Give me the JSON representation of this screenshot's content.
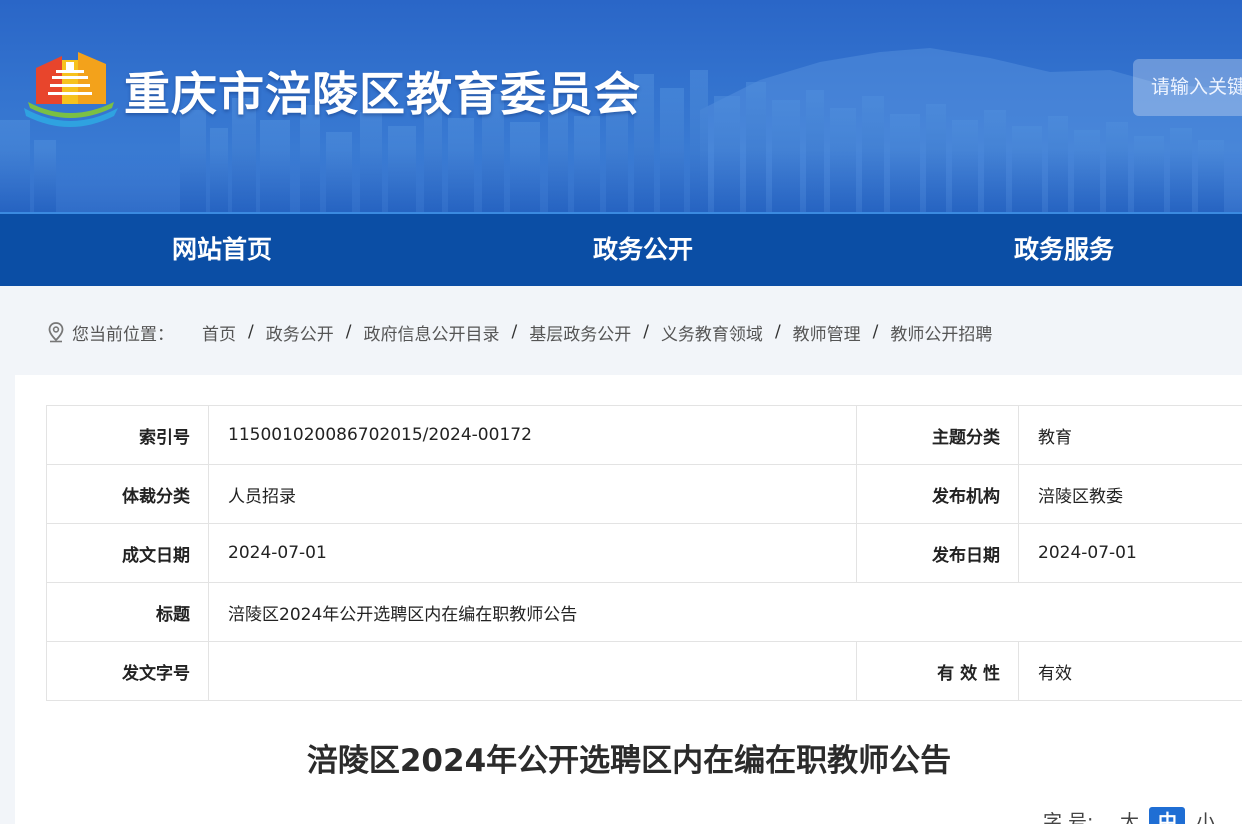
{
  "header": {
    "site_title": "重庆市涪陵区教育委员会",
    "search_placeholder": "请输入关键"
  },
  "nav": {
    "items": [
      "网站首页",
      "政务公开",
      "政务服务"
    ]
  },
  "breadcrumb": {
    "label": "您当前位置：",
    "items": [
      "首页",
      "政务公开",
      "政府信息公开目录",
      "基层政务公开",
      "义务教育领域",
      "教师管理",
      "教师公开招聘"
    ],
    "separator": "/"
  },
  "meta": {
    "index_no_label": "索引号",
    "index_no": "115001020086702015/2024-00172",
    "subject_label": "主题分类",
    "subject": "教育",
    "genre_label": "体裁分类",
    "genre": "人员招录",
    "publisher_label": "发布机构",
    "publisher": "涪陵区教委",
    "written_date_label": "成文日期",
    "written_date": "2024-07-01",
    "publish_date_label": "发布日期",
    "publish_date": "2024-07-01",
    "title_label": "标题",
    "title": "涪陵区2024年公开选聘区内在编在职教师公告",
    "doc_no_label": "发文字号",
    "doc_no": "",
    "validity_label": "有 效 性",
    "validity": "有效"
  },
  "article": {
    "title": "涪陵区2024年公开选聘区内在编在职教师公告"
  },
  "font_size": {
    "label": "字 号:",
    "options": [
      "大",
      "中",
      "小"
    ],
    "selected": "中"
  },
  "colors": {
    "nav_bg": "#0b4ea5",
    "banner_blue": "#3474cf",
    "accent": "#1f6ed4"
  }
}
